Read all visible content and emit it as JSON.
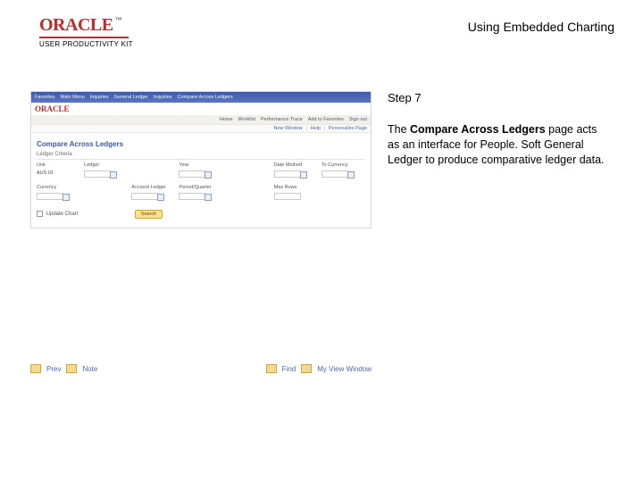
{
  "header": {
    "brand": "ORACLE",
    "brand_sub": "USER PRODUCTIVITY KIT",
    "title": "Using Embedded Charting"
  },
  "ps": {
    "nav": [
      "Favorites",
      "Main Menu",
      "Inquiries",
      "General Ledger",
      "Inquiries",
      "Compare Across Ledgers"
    ],
    "subnav": [
      "Home",
      "Worklist",
      "Performance Trace",
      "Add to Favorites",
      "Sign out"
    ],
    "subbar": [
      "New Window",
      "Help",
      "Personalize Page"
    ],
    "brand_mini": "ORACLE",
    "page_title": "Compare Across Ledgers",
    "section": "Ledger Criteria",
    "labels": [
      "Unit",
      "Ledger",
      "Year",
      "Date Method",
      "To Currency"
    ],
    "labels2": [
      "Currency",
      "Account Ledger",
      "Period/Quarter",
      "Max Rows"
    ],
    "unit_val": "AUS 01",
    "search_btn": "Search",
    "checkbox_label": "Update Chart"
  },
  "navstrip": {
    "prev": "Prev",
    "note": "Note",
    "find": "Find",
    "more": "My View Window"
  },
  "step": {
    "label": "Step 7",
    "bold": "Compare Across Ledgers",
    "before": "The ",
    "after": " page acts as an interface for People. Soft General Ledger to produce comparative ledger data."
  }
}
